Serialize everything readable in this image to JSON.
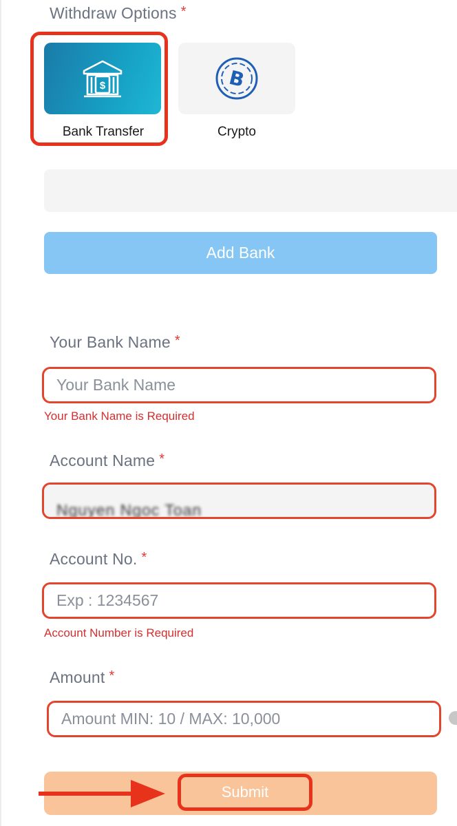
{
  "withdraw": {
    "label": "Withdraw Options",
    "required_mark": "*",
    "options": [
      {
        "label": "Bank Transfer",
        "icon": "bank-icon",
        "selected": true
      },
      {
        "label": "Crypto",
        "icon": "bitcoin-icon",
        "selected": false
      }
    ]
  },
  "add_bank_label": "Add Bank",
  "fields": {
    "bank_name": {
      "label": "Your Bank Name",
      "placeholder": "Your Bank Name",
      "error": "Your Bank Name is Required"
    },
    "account_name": {
      "label": "Account Name",
      "value": "Nguyen Ngoc Toan"
    },
    "account_no": {
      "label": "Account No.",
      "placeholder": "Exp : 1234567",
      "error": "Account Number is Required"
    },
    "amount": {
      "label": "Amount",
      "placeholder": "Amount MIN: 10 / MAX: 10,000"
    }
  },
  "submit_label": "Submit",
  "colors": {
    "accent_blue": "#85c6f4",
    "bank_card": "#1b7aa8",
    "error": "#d32f2f",
    "highlight": "#e8331c",
    "submit": "#fac49a"
  }
}
